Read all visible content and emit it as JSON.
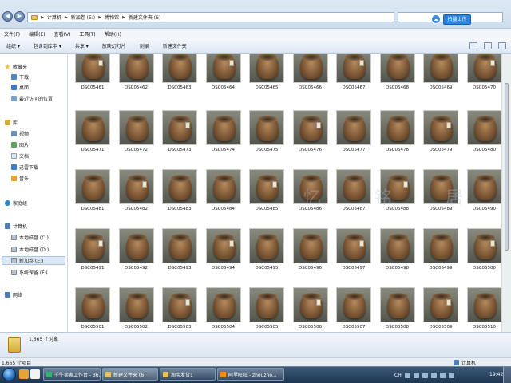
{
  "address": {
    "crumbs": [
      "计算机",
      "新加卷 (E:)",
      "博物馆",
      "新建文件夹 (6)"
    ],
    "sogou_button": "拍搜上传"
  },
  "menu": [
    "文件(F)",
    "编辑(E)",
    "查看(V)",
    "工具(T)",
    "帮助(H)"
  ],
  "commands": [
    "组织 ▾",
    "包含到库中 ▾",
    "共享 ▾",
    "放映幻灯片",
    "刻录",
    "新建文件夹"
  ],
  "nav": {
    "favorites": "收藏夹",
    "downloads": "下载",
    "desktop": "桌面",
    "recent": "最近访问的位置",
    "libraries": "库",
    "video": "视频",
    "pictures": "图片",
    "documents": "文档",
    "thunder": "迅雷下载",
    "music": "音乐",
    "homegroup": "家庭组",
    "computer": "计算机",
    "drive_c": "本地磁盘 (C:)",
    "drive_d": "本地磁盘 (D:)",
    "drive_e": "新加卷 (E:)",
    "drive_f": "系统保留 (F:)",
    "network": "网络"
  },
  "files": [
    "DSC05461",
    "DSC05462",
    "DSC05463",
    "DSC05464",
    "DSC05465",
    "DSC05466",
    "DSC05467",
    "DSC05468",
    "DSC05469",
    "DSC05470",
    "DSC05471",
    "DSC05472",
    "DSC05473",
    "DSC05474",
    "DSC05475",
    "DSC05476",
    "DSC05477",
    "DSC05478",
    "DSC05479",
    "DSC05480",
    "DSC05481",
    "DSC05482",
    "DSC05483",
    "DSC05484",
    "DSC05485",
    "DSC05486",
    "DSC05487",
    "DSC05488",
    "DSC05489",
    "DSC05490",
    "DSC05491",
    "DSC05492",
    "DSC05493",
    "DSC05494",
    "DSC05495",
    "DSC05496",
    "DSC05497",
    "DSC05498",
    "DSC05499",
    "DSC05500",
    "DSC05501",
    "DSC05502",
    "DSC05503",
    "DSC05504",
    "DSC05505",
    "DSC05506",
    "DSC05507",
    "DSC05508",
    "DSC05509",
    "DSC05510"
  ],
  "details": {
    "count": "1,665 个对象"
  },
  "status": {
    "left": "1,665 个项目",
    "right": "计算机"
  },
  "taskbar": {
    "tasks": [
      "千牛卖家工作台 - 36...",
      "新建文件夹 (6)",
      "淘宝发货1",
      "阿里旺旺 - zhouzho..."
    ],
    "tray_lang": "CH",
    "clock": "19:42"
  },
  "watermark": "忆 铭 居"
}
